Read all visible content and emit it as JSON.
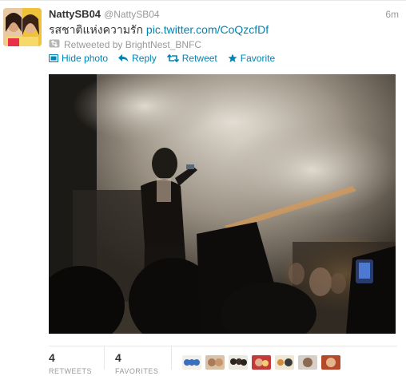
{
  "tweet": {
    "fullname": "NattySB04",
    "username": "@NattySB04",
    "time": "6m",
    "text": "รสชาติแห่งความรัก",
    "link": "pic.twitter.com/CoQzcfDf",
    "retweeted_by": "Retweeted by BrightNest_BNFC"
  },
  "actions": {
    "hide_photo": "Hide photo",
    "reply": "Reply",
    "retweet": "Retweet",
    "favorite": "Favorite"
  },
  "stats": {
    "retweets_count": "4",
    "retweets_label": "RETWEETS",
    "favorites_count": "4",
    "favorites_label": "FAVORITES"
  },
  "colors": {
    "link": "#0084b4",
    "muted": "#999999",
    "text": "#333333"
  },
  "icons": [
    "photo-icon",
    "reply-icon",
    "retweet-icon",
    "favorite-icon",
    "retweet-small-icon"
  ]
}
